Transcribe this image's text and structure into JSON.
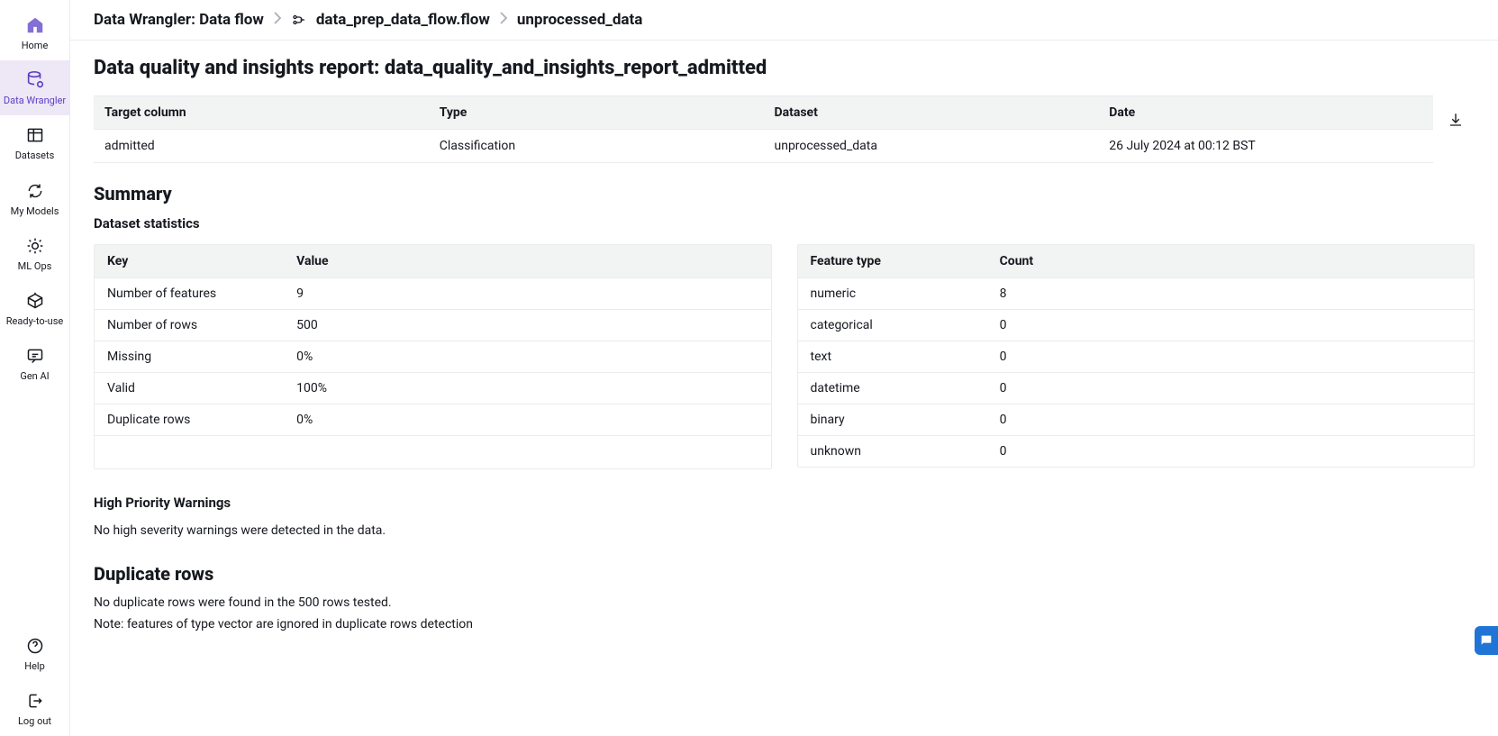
{
  "sidebar": {
    "items": [
      {
        "label": "Home"
      },
      {
        "label": "Data Wrangler"
      },
      {
        "label": "Datasets"
      },
      {
        "label": "My Models"
      },
      {
        "label": "ML Ops"
      },
      {
        "label": "Ready-to-use"
      },
      {
        "label": "Gen AI"
      }
    ],
    "bottom": [
      {
        "label": "Help"
      },
      {
        "label": "Log out"
      }
    ]
  },
  "breadcrumb": {
    "root": "Data Wrangler: Data flow",
    "flow": "data_prep_data_flow.flow",
    "node": "unprocessed_data"
  },
  "page_title": "Data quality and insights report: data_quality_and_insights_report_admitted",
  "info_table": {
    "headers": {
      "target": "Target column",
      "type": "Type",
      "dataset": "Dataset",
      "date": "Date"
    },
    "row": {
      "target": "admitted",
      "type": "Classification",
      "dataset": "unprocessed_data",
      "date": "26 July 2024 at 00:12 BST"
    }
  },
  "summary": {
    "heading": "Summary",
    "stats_heading": "Dataset statistics",
    "left_headers": {
      "key": "Key",
      "value": "Value"
    },
    "left_rows": [
      {
        "key": "Number of features",
        "value": "9"
      },
      {
        "key": "Number of rows",
        "value": "500"
      },
      {
        "key": "Missing",
        "value": "0%"
      },
      {
        "key": "Valid",
        "value": "100%"
      },
      {
        "key": "Duplicate rows",
        "value": "0%"
      }
    ],
    "right_headers": {
      "key": "Feature type",
      "value": "Count"
    },
    "right_rows": [
      {
        "key": "numeric",
        "value": "8"
      },
      {
        "key": "categorical",
        "value": "0"
      },
      {
        "key": "text",
        "value": "0"
      },
      {
        "key": "datetime",
        "value": "0"
      },
      {
        "key": "binary",
        "value": "0"
      },
      {
        "key": "unknown",
        "value": "0"
      }
    ]
  },
  "warnings": {
    "heading": "High Priority Warnings",
    "text": "No high severity warnings were detected in the data."
  },
  "duplicates": {
    "heading": "Duplicate rows",
    "line1": "No duplicate rows were found in the 500 rows tested.",
    "line2": "Note: features of type vector are ignored in duplicate rows detection"
  }
}
